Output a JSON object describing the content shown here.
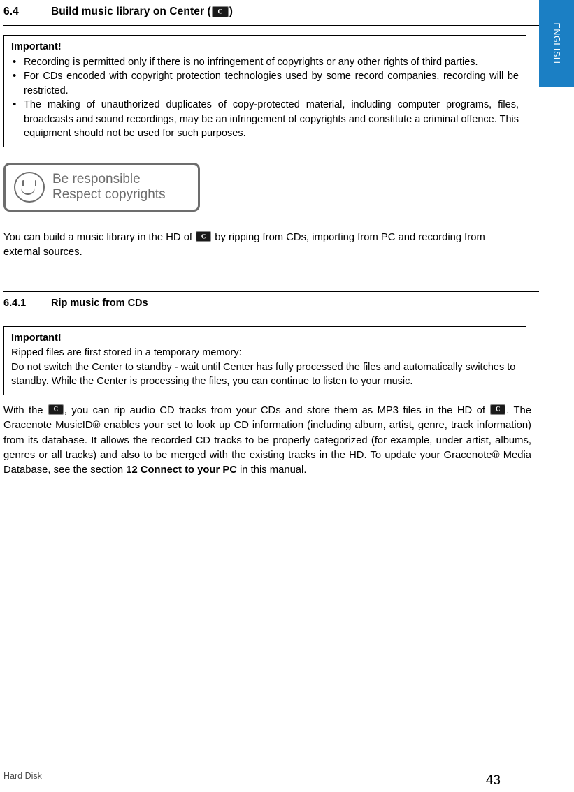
{
  "language_tab": {
    "label": "ENGLISH",
    "color": "#1b7fc4"
  },
  "section": {
    "number": "6.4",
    "title_prefix": "Build music library on Center (",
    "title_suffix": ")",
    "device_icon": "center-device-icon"
  },
  "important_box_1": {
    "title": "Important!",
    "bullets": [
      "Recording is permitted only if there is no infringement of copyrights or any other rights of third parties.",
      "For CDs encoded with copyright protection technologies used by some record companies, recording will be restricted.",
      "The making of unauthorized duplicates of copy-protected material, including computer programs, files, broadcasts and sound recordings, may be an infringement of copyrights and constitute a criminal offence. This equipment should not be used for such purposes."
    ]
  },
  "badge": {
    "line1": "Be responsible",
    "line2": "Respect copyrights",
    "icon": "smiley-face-icon",
    "color": "#6d6d6d"
  },
  "intro_paragraph": {
    "part1": "You can build a music library in the HD of ",
    "part2": " by ripping from CDs, importing from PC and recording from external sources."
  },
  "subsection": {
    "number": "6.4.1",
    "title": "Rip music from CDs"
  },
  "important_box_2": {
    "title": "Important!",
    "lines": [
      "Ripped files are first stored in a temporary memory:",
      "Do not switch the Center to standby - wait until Center has fully processed the files and automatically switches to standby. While the Center is processing the files, you can continue to listen to your music."
    ]
  },
  "rip_paragraph": {
    "part1": "With the ",
    "part2": ", you can rip audio CD tracks from your CDs and store them as MP3 files in the HD of ",
    "part3": ". The Gracenote MusicID®  enables your set to look up CD information (including album, artist, genre, track information) from its database. It allows the recorded CD tracks to be properly categorized (for example, under artist, albums, genres or all tracks) and also to be merged with the existing tracks in the HD. To update your Gracenote® Media Database, see the section ",
    "bold_ref": "12 Connect to your PC",
    "part4": " in this manual."
  },
  "footer": {
    "left": "Hard Disk",
    "page_number": "43"
  }
}
